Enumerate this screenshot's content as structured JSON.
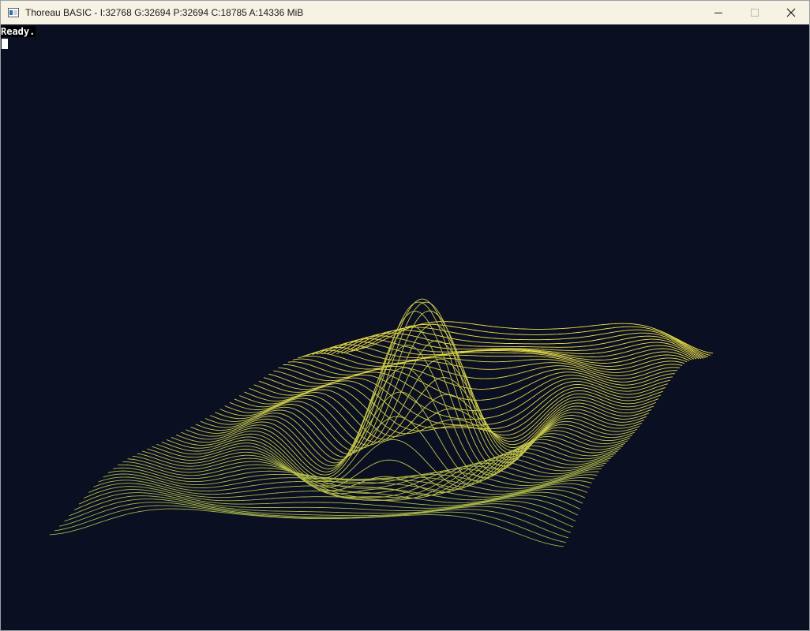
{
  "window": {
    "title": "Thoreau BASIC - I:32768 G:32694 P:32694 C:18785 A:14336 MiB",
    "app_icon": "console-window-icon",
    "controls": {
      "minimize_icon": "minimize-icon",
      "maximize_icon": "maximize-icon",
      "close_icon": "close-icon"
    }
  },
  "console": {
    "status_text": "Ready.",
    "cursor": "block-cursor"
  },
  "colors": {
    "background": "#0a0f22",
    "titlebar": "#f7f3e4",
    "mesh_front": "#a3b24a",
    "mesh_back": "#f2e24a"
  }
}
